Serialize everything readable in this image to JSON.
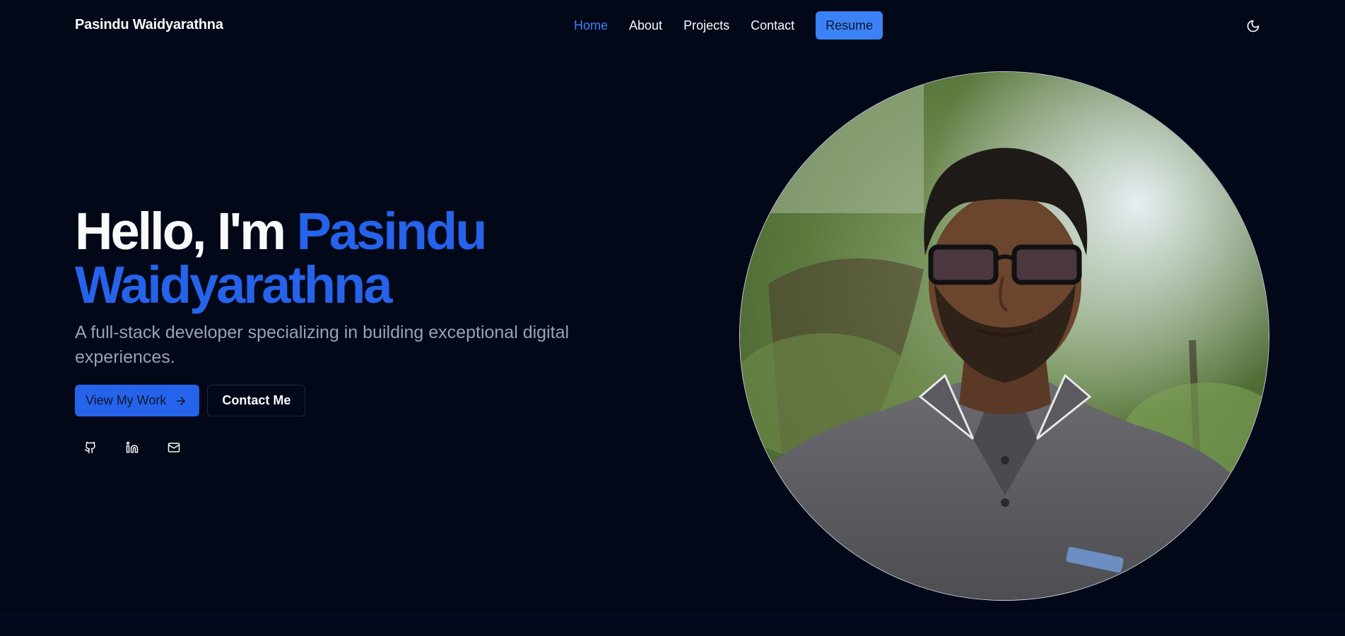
{
  "header": {
    "brand": "Pasindu Waidyarathna",
    "nav": [
      {
        "label": "Home",
        "active": true
      },
      {
        "label": "About",
        "active": false
      },
      {
        "label": "Projects",
        "active": false
      },
      {
        "label": "Contact",
        "active": false
      }
    ],
    "resume_label": "Resume",
    "theme_icon": "moon-icon"
  },
  "hero": {
    "greeting": "Hello, I'm ",
    "name_line1": "Pasindu",
    "name_line2": "Waidyarathna",
    "subtitle": "A full-stack developer specializing in building exceptional digital experiences.",
    "primary_cta": "View My Work",
    "primary_cta_icon": "arrow-right-icon",
    "secondary_cta": "Contact Me",
    "socials": [
      {
        "icon": "github-icon"
      },
      {
        "icon": "linkedin-icon"
      },
      {
        "icon": "mail-icon"
      }
    ]
  },
  "colors": {
    "background": "#020817",
    "accent": "#2563eb",
    "nav_active": "#3b82f6",
    "muted_text": "#94a3b8"
  }
}
